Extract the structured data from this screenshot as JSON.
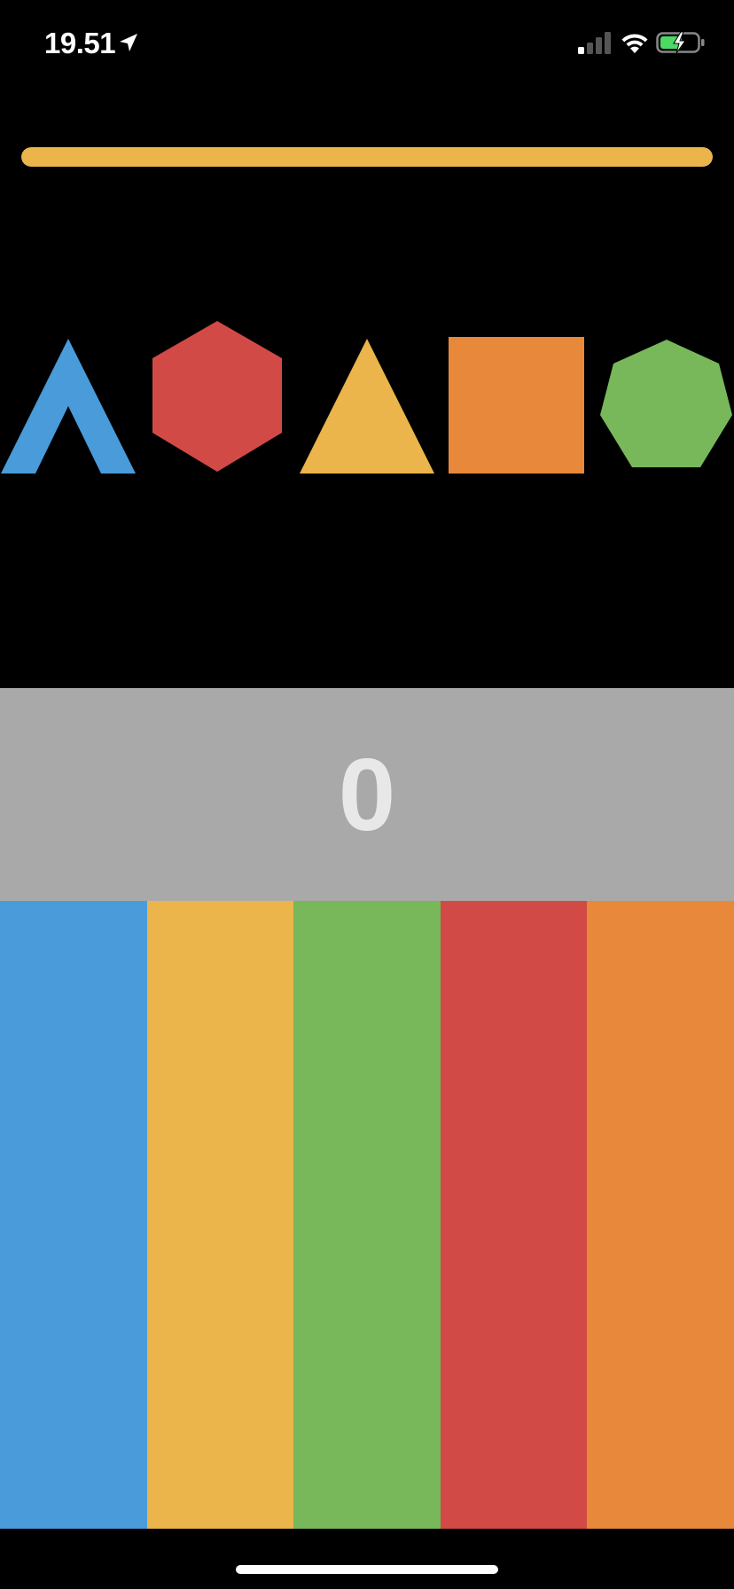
{
  "status_bar": {
    "time": "19.51",
    "icons": [
      "location-arrow-icon",
      "cellular-signal-icon",
      "wifi-icon",
      "battery-charging-icon"
    ]
  },
  "timer": {
    "fraction_remaining": 1.0,
    "color": "#ecb54b"
  },
  "shapes": [
    {
      "name": "chevron",
      "color": "#4a9bda"
    },
    {
      "name": "hexagon",
      "color": "#d24a46"
    },
    {
      "name": "triangle",
      "color": "#ecb54b"
    },
    {
      "name": "square",
      "color": "#e8883b"
    },
    {
      "name": "heptagon",
      "color": "#78b85a"
    }
  ],
  "score": {
    "value": "0",
    "panel_color": "#a9a9a9"
  },
  "color_buttons": [
    {
      "name": "blue",
      "color": "#4a9bda"
    },
    {
      "name": "yellow",
      "color": "#ecb54b"
    },
    {
      "name": "green",
      "color": "#78b85a"
    },
    {
      "name": "red",
      "color": "#d24a46"
    },
    {
      "name": "orange",
      "color": "#e8883b"
    }
  ]
}
